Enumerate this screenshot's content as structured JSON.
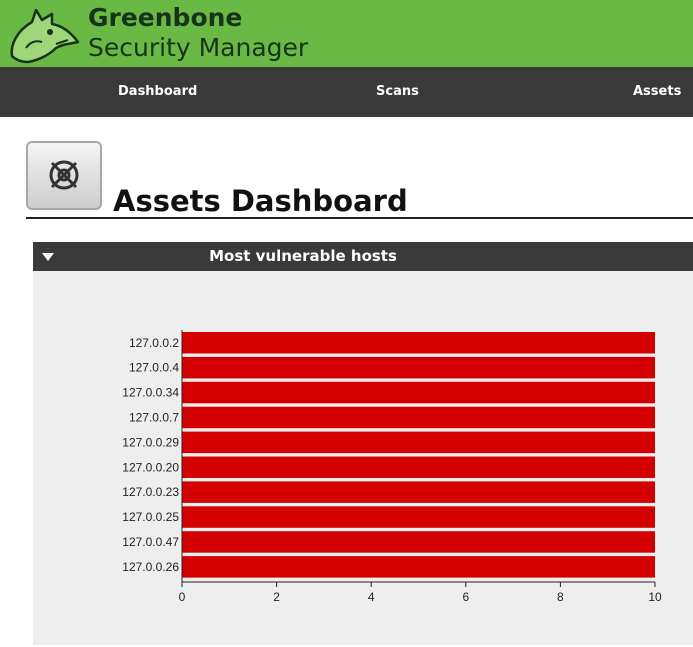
{
  "header": {
    "brand_line1": "Greenbone",
    "brand_line2": "Security Manager",
    "logo_icon": "greenbone-dragon-logo-icon",
    "color": "#6ab944"
  },
  "nav": {
    "items": [
      {
        "label": "Dashboard"
      },
      {
        "label": "Scans"
      },
      {
        "label": "Assets"
      }
    ],
    "color": "#3a3a3a"
  },
  "page": {
    "title": "Assets Dashboard",
    "icon": "assets-target-icon"
  },
  "panel": {
    "title": "Most vulnerable hosts",
    "collapse_icon": "triangle-down-icon"
  },
  "chart_data": {
    "type": "bar",
    "orientation": "horizontal",
    "categories": [
      "127.0.0.2",
      "127.0.0.4",
      "127.0.0.34",
      "127.0.0.7",
      "127.0.0.29",
      "127.0.0.20",
      "127.0.0.23",
      "127.0.0.25",
      "127.0.0.47",
      "127.0.0.26"
    ],
    "values": [
      10,
      10,
      10,
      10,
      10,
      10,
      10,
      10,
      10,
      10
    ],
    "xlim": [
      0,
      10
    ],
    "xticks": [
      0,
      2,
      4,
      6,
      8,
      10
    ],
    "bar_color": "#d40000",
    "grid": false
  }
}
